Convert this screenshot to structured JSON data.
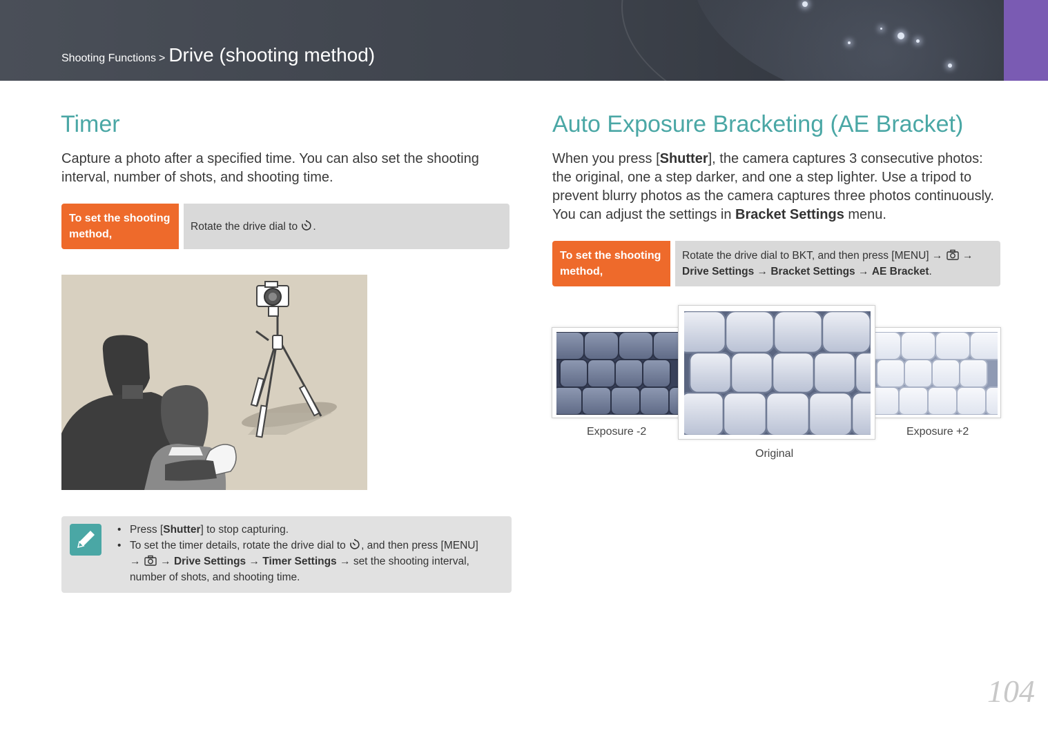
{
  "header": {
    "breadcrumb_section": "Shooting Functions",
    "breadcrumb_separator": ">",
    "breadcrumb_page": "Drive (shooting method)"
  },
  "timer": {
    "title": "Timer",
    "description": "Capture a photo after a specified time. You can also set the shooting interval, number of shots, and shooting time.",
    "method_label": "To set the shooting method,",
    "method_text_pre": "Rotate the drive dial to",
    "method_text_post": ".",
    "notes": {
      "n1_pre": "Press [",
      "n1_bold": "Shutter",
      "n1_post": "] to stop capturing.",
      "n2_pre": "To set the timer details, rotate the drive dial to",
      "n2_mid": ", and then press [",
      "n2_menu": "MENU",
      "n2_close": "]",
      "arrow": "→",
      "n2_drive": "Drive Settings",
      "n2_timer": "Timer Settings",
      "n2_post": "set the shooting interval, number of shots, and shooting time."
    }
  },
  "ae_bracket": {
    "title": "Auto Exposure Bracketing (AE Bracket)",
    "desc_pre": "When you press [",
    "desc_bold1": "Shutter",
    "desc_mid": "], the camera captures 3 consecutive photos: the original, one a step darker, and one a step lighter. Use a tripod to prevent blurry photos as the camera captures three photos continuously. You can adjust the settings in ",
    "desc_bold2": "Bracket Settings",
    "desc_post": " menu.",
    "method_label": "To set the shooting method,",
    "method_pre": "Rotate the drive dial to",
    "method_bkt": "BKT",
    "method_mid": ", and then press [",
    "method_menu": "MENU",
    "method_close": "]",
    "arrow": "→",
    "drive_settings": "Drive Settings",
    "bracket_settings": "Bracket Settings",
    "ae_bracket": "AE Bracket",
    "period": ".",
    "captions": {
      "minus": "Exposure -2",
      "original": "Original",
      "plus": "Exposure +2"
    }
  },
  "page_number": "104",
  "colors": {
    "accent_teal": "#4aa7a5",
    "accent_orange": "#ee6a2b",
    "header_tab_purple": "#7a5bb3"
  }
}
